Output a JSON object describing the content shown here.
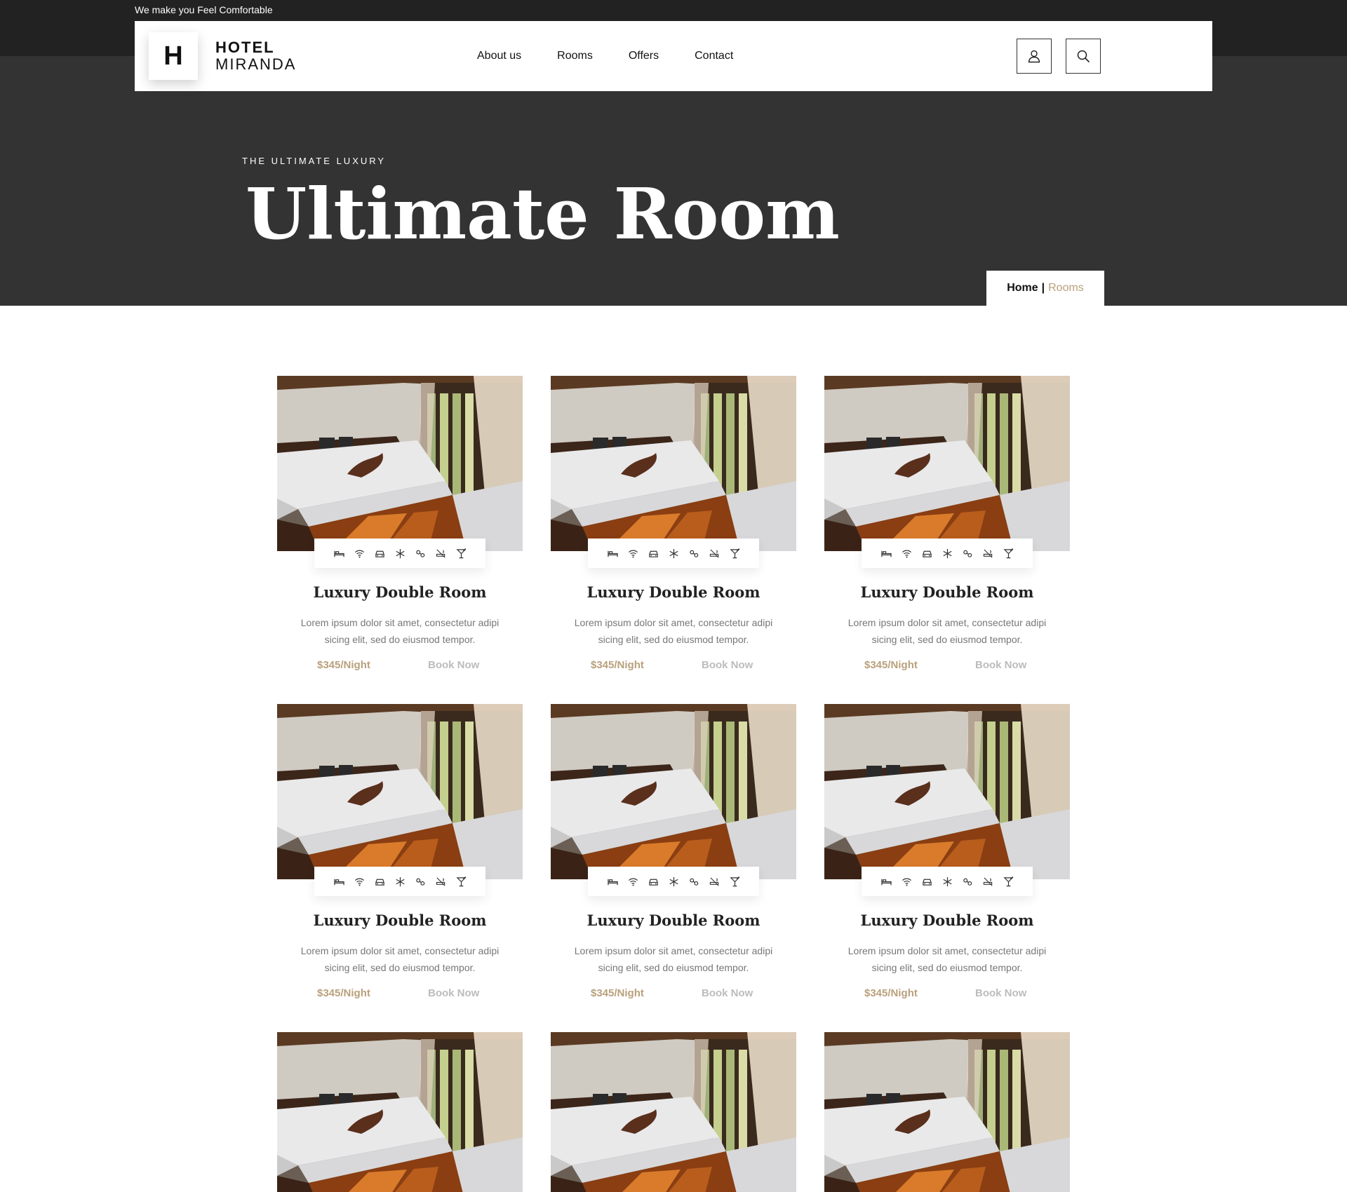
{
  "header": {
    "tagline": "We make you Feel Comfortable",
    "logo_letter": "H",
    "logo_line1": "HOTEL",
    "logo_line2": "MIRANDA",
    "nav": [
      "About us",
      "Rooms",
      "Offers",
      "Contact"
    ],
    "user_icon": "user-icon",
    "search_icon": "search-icon"
  },
  "hero": {
    "eyebrow": "THE ULTIMATE LUXURY",
    "title": "Ultimate Room"
  },
  "breadcrumb": {
    "home": "Home",
    "separator": "|",
    "current": "Rooms"
  },
  "colors": {
    "accent": "#b9a07c",
    "dark": "#333333",
    "top": "#222222",
    "muted_link": "#bcbcbc"
  },
  "amenity_icons": [
    "bed-icon",
    "wifi-icon",
    "car-icon",
    "snowflake-icon",
    "pets-icon",
    "no-smoking-icon",
    "cocktail-icon"
  ],
  "rooms": [
    {
      "title": "Luxury Double Room",
      "description": "Lorem ipsum dolor sit amet, consectetur adipi sicing elit, sed do eiusmod tempor.",
      "price": "$345/Night",
      "cta": "Book Now"
    },
    {
      "title": "Luxury Double Room",
      "description": "Lorem ipsum dolor sit amet, consectetur adipi sicing elit, sed do eiusmod tempor.",
      "price": "$345/Night",
      "cta": "Book Now"
    },
    {
      "title": "Luxury Double Room",
      "description": "Lorem ipsum dolor sit amet, consectetur adipi sicing elit, sed do eiusmod tempor.",
      "price": "$345/Night",
      "cta": "Book Now"
    },
    {
      "title": "Luxury Double Room",
      "description": "Lorem ipsum dolor sit amet, consectetur adipi sicing elit, sed do eiusmod tempor.",
      "price": "$345/Night",
      "cta": "Book Now"
    },
    {
      "title": "Luxury Double Room",
      "description": "Lorem ipsum dolor sit amet, consectetur adipi sicing elit, sed do eiusmod tempor.",
      "price": "$345/Night",
      "cta": "Book Now"
    },
    {
      "title": "Luxury Double Room",
      "description": "Lorem ipsum dolor sit amet, consectetur adipi sicing elit, sed do eiusmod tempor.",
      "price": "$345/Night",
      "cta": "Book Now"
    },
    {
      "title": "",
      "description": "",
      "price": "",
      "cta": ""
    },
    {
      "title": "",
      "description": "",
      "price": "",
      "cta": ""
    },
    {
      "title": "",
      "description": "",
      "price": "",
      "cta": ""
    }
  ]
}
